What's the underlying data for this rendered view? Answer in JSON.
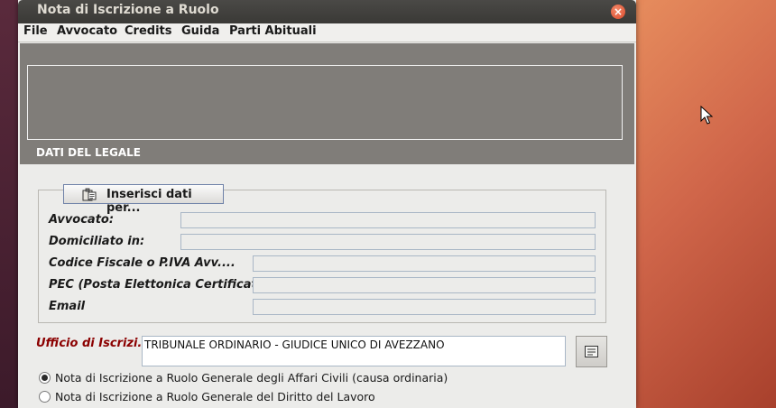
{
  "window": {
    "title": "Nota di Iscrizione a Ruolo",
    "close_glyph": "×"
  },
  "menubar": {
    "items": [
      {
        "label": "File"
      },
      {
        "label": "Avvocato"
      },
      {
        "label": "Credits"
      },
      {
        "label": "Guida"
      },
      {
        "label": "Parti Abituali"
      }
    ]
  },
  "header": {
    "section_title": "DATI DEL LEGALE"
  },
  "legale": {
    "insert_button": {
      "label": "Inserisci dati per...",
      "icon": "clipboard-icon"
    },
    "fields": [
      {
        "label": "Avvocato:",
        "value": ""
      },
      {
        "label": "Domiciliato in:",
        "value": ""
      },
      {
        "label": "Codice Fiscale o P.IVA Avv....",
        "value": ""
      },
      {
        "label": "PEC (Posta Elettonica Certificata)",
        "value": ""
      },
      {
        "label": "Email",
        "value": ""
      }
    ]
  },
  "ufficio": {
    "label": "Ufficio di Iscrizi...",
    "value": "TRIBUNALE ORDINARIO - GIUDICE UNICO DI AVEZZANO",
    "picker_icon": "list-picker-icon"
  },
  "options": [
    {
      "label": "Nota di Iscrizione a Ruolo Generale degli Affari Civili (causa ordinaria)",
      "selected": true
    },
    {
      "label": "Nota di Iscrizione a Ruolo Generale del Diritto del Lavoro",
      "selected": false
    }
  ],
  "colors": {
    "required_label": "#8b0000",
    "header_panel": "#807d79",
    "close_button": "#d9482a"
  }
}
